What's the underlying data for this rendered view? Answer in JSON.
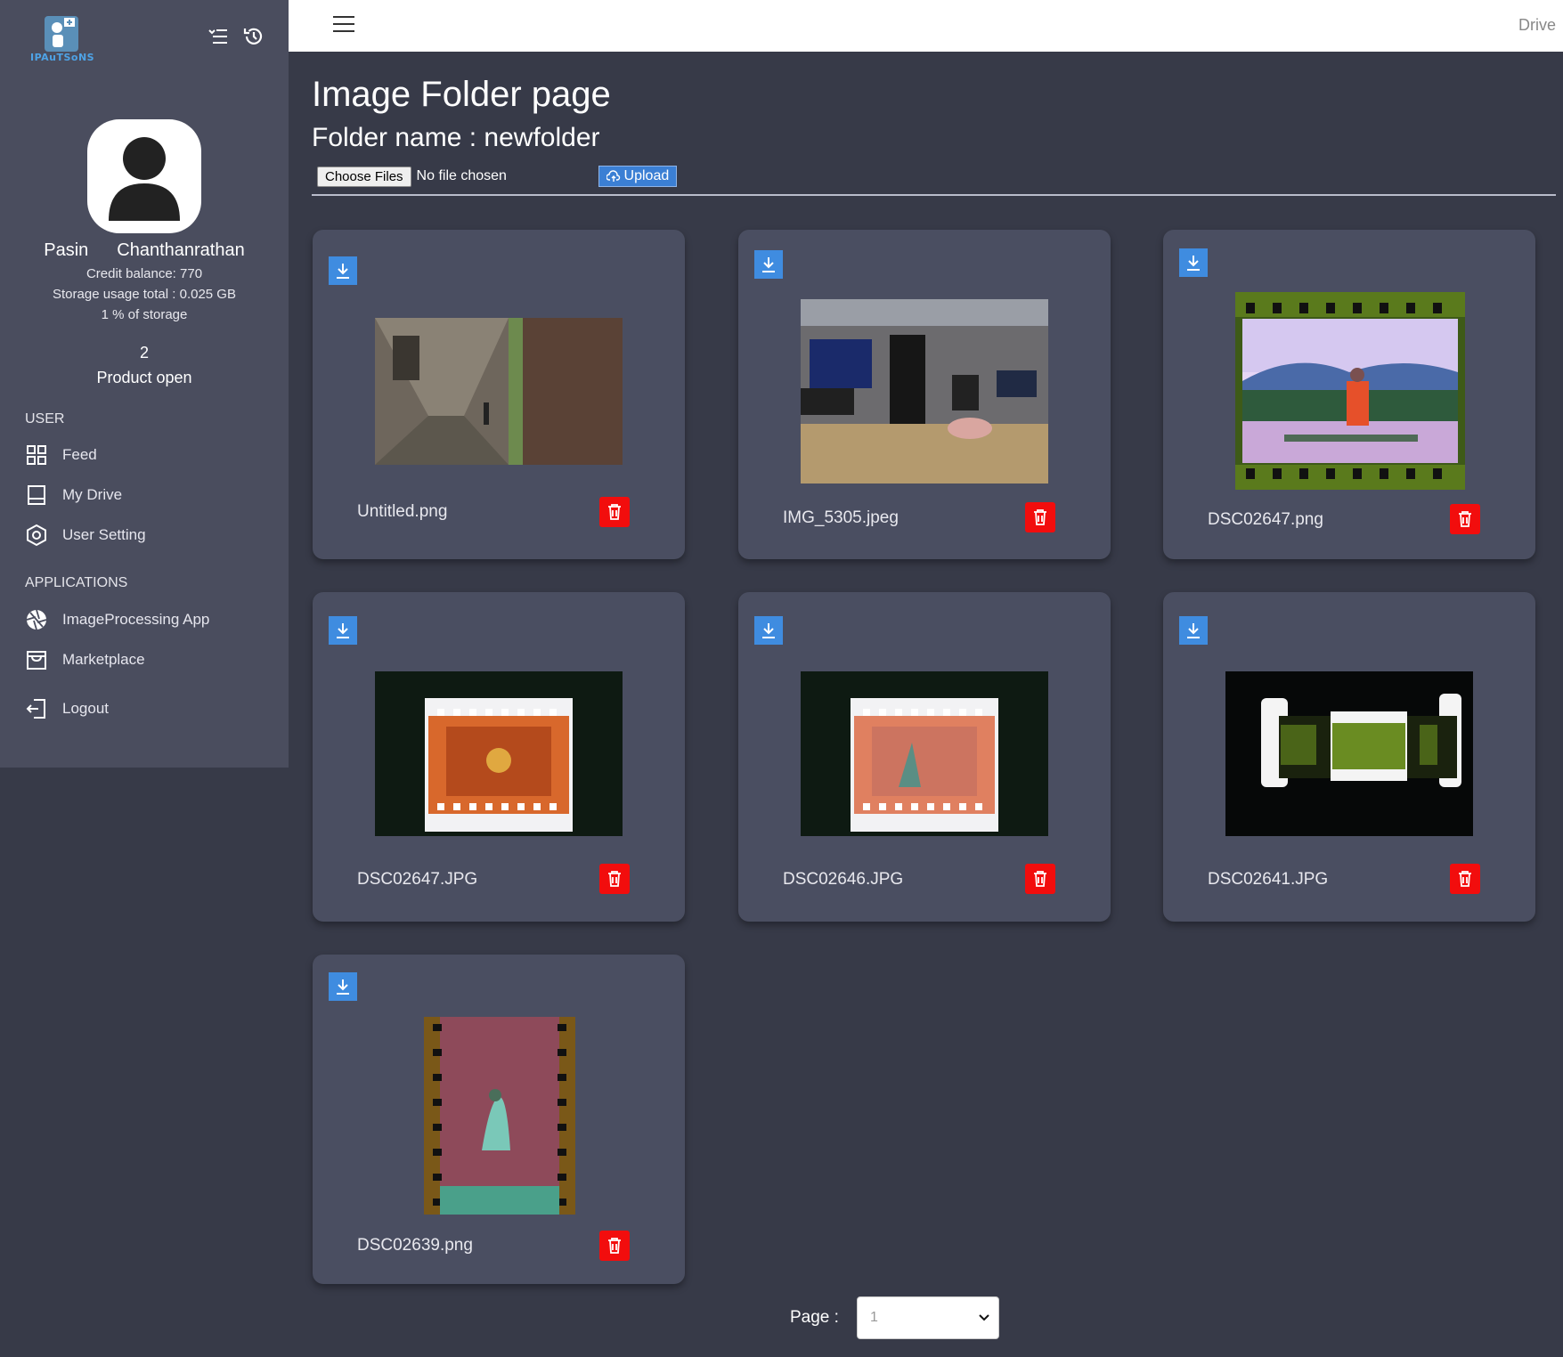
{
  "app": {
    "logo_text": "IPAuTSoNS"
  },
  "header": {
    "right_label": "Drive"
  },
  "profile": {
    "first_name": "Pasin",
    "last_name": "Chanthanrathan",
    "credit": "Credit balance: 770",
    "storage": "Storage usage total : 0.025 GB",
    "storage_pct": "1 % of storage",
    "product_count": "2",
    "product_label": "Product open"
  },
  "sidebar": {
    "user_section": "USER",
    "feed": "Feed",
    "my_drive": "My Drive",
    "user_setting": "User Setting",
    "apps_section": "APPLICATIONS",
    "image_processing": "ImageProcessing App",
    "marketplace": "Marketplace",
    "logout": "Logout"
  },
  "main": {
    "title": "Image Folder page",
    "folder": "Folder name : newfolder",
    "choose_files": "Choose Files",
    "no_file": "No file chosen",
    "upload": "Upload"
  },
  "files": [
    {
      "name": "Untitled.png"
    },
    {
      "name": "IMG_5305.jpeg"
    },
    {
      "name": "DSC02647.png"
    },
    {
      "name": "DSC02647.JPG"
    },
    {
      "name": "DSC02646.JPG"
    },
    {
      "name": "DSC02641.JPG"
    },
    {
      "name": "DSC02639.png"
    }
  ],
  "pager": {
    "label": "Page :",
    "value": "1"
  },
  "colors": {
    "background": "#373a48",
    "sidebar": "#4a4d5e",
    "card": "#4a4e61",
    "download": "#3f8ce0",
    "delete": "#f20d0d",
    "upload": "#3b7fd4"
  }
}
